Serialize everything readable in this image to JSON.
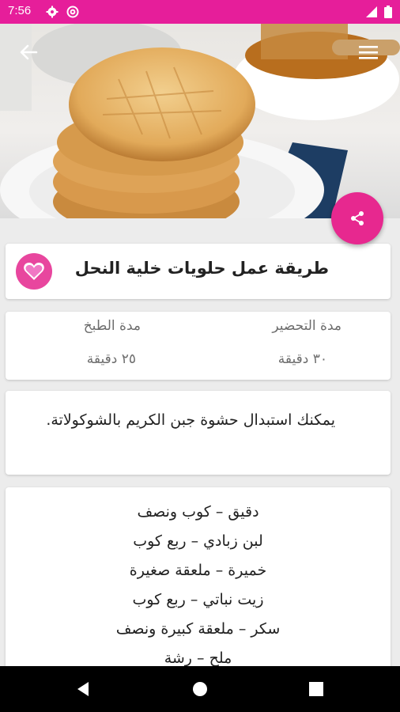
{
  "status_bar": {
    "time": "7:56",
    "left_icons": [
      "gear-icon",
      "at-sign-icon"
    ],
    "right_icons": [
      "signal-icon",
      "battery-icon"
    ],
    "color": "#e61e9a"
  },
  "app_bar": {
    "back_icon": "arrow-left-icon",
    "menu_icon": "hamburger-menu-icon"
  },
  "share_icon": "share-icon",
  "recipe": {
    "title": "طريقة عمل حلويات خلية النحل",
    "favorite_icon": "heart-icon"
  },
  "times": {
    "prep_label": "مدة التحضير",
    "prep_value": "٣٠ دقيقة",
    "cook_label": "مدة الطبخ",
    "cook_value": "٢٥ دقيقة"
  },
  "tip": "يمكنك استبدال حشوة جبن الكريم بالشوكولاتة.",
  "ingredients": [
    "دقيق – كوب ونصف",
    "لبن زبادي – ربع كوب",
    "خميرة – ملعقة صغيرة",
    "زيت نباتي – ربع كوب",
    "سكر – ملعقة كبيرة ونصف",
    "ملح – رشة"
  ],
  "nav": {
    "back": "nav-back-icon",
    "home": "nav-home-icon",
    "recents": "nav-recents-icon"
  },
  "colors": {
    "accent": "#e7288f",
    "heart": "#e8469e"
  }
}
